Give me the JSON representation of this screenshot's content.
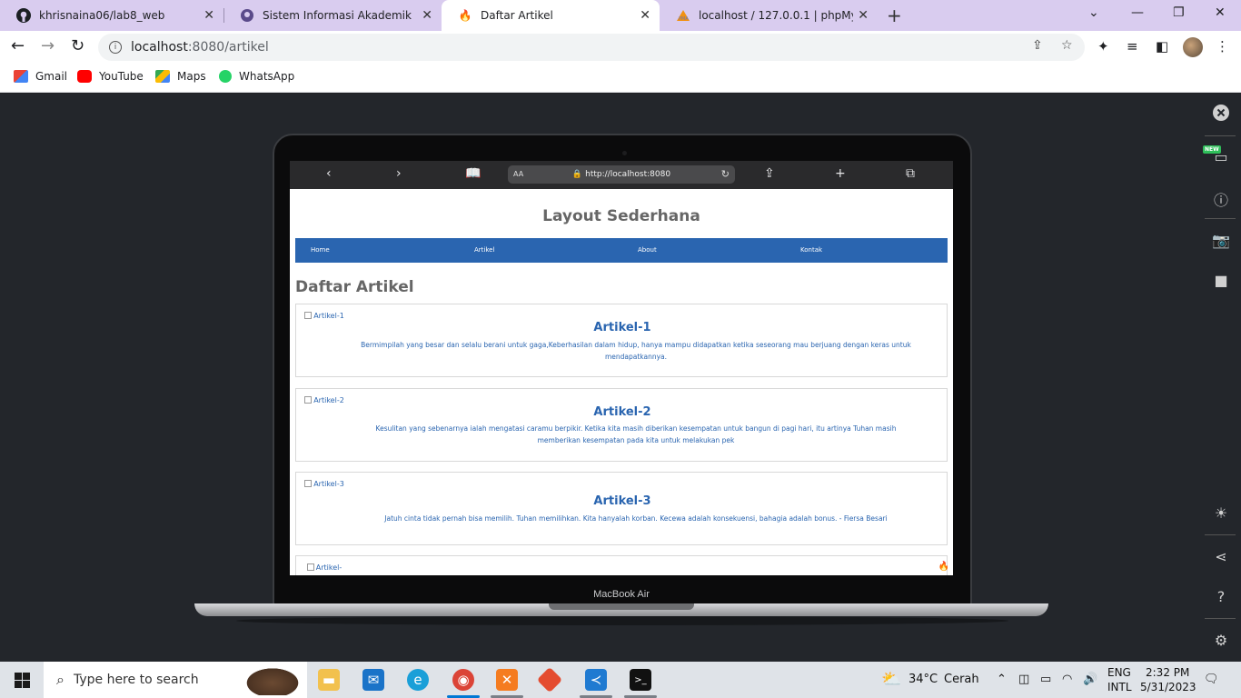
{
  "browser": {
    "tabs": [
      {
        "title": "khrisnaina06/lab8_web",
        "icon": "github-icon",
        "active": false
      },
      {
        "title": "Sistem Informasi Akademik",
        "icon": "academic-icon",
        "active": false
      },
      {
        "title": "Daftar Artikel",
        "icon": "flame-icon",
        "active": true
      },
      {
        "title": "localhost / 127.0.0.1 | phpMyAdmin",
        "icon": "phpmyadmin-icon",
        "active": false
      }
    ],
    "url_host": "localhost",
    "url_path": ":8080/artikel",
    "bookmarks": [
      {
        "label": "Gmail",
        "color": "#ea4335"
      },
      {
        "label": "YouTube",
        "color": "#ff0000"
      },
      {
        "label": "Maps",
        "color": "#34a853"
      },
      {
        "label": "WhatsApp",
        "color": "#25d366"
      }
    ]
  },
  "device": {
    "label": "MacBook Air",
    "safari_url": "http://localhost:8080",
    "safari_aa": "AA"
  },
  "site": {
    "title": "Layout Sederhana",
    "nav": [
      "Home",
      "Artikel",
      "About",
      "Kontak"
    ],
    "heading": "Daftar Artikel",
    "articles": [
      {
        "img_alt": "Artikel-1",
        "title": "Artikel-1",
        "desc": "Bermimpilah yang besar dan selalu berani untuk gaga,Keberhasilan dalam hidup, hanya mampu didapatkan ketika seseorang mau berjuang dengan keras untuk mendapatkannya."
      },
      {
        "img_alt": "Artikel-2",
        "title": "Artikel-2",
        "desc": "Kesulitan yang sebenarnya ialah mengatasi caramu berpikir. Ketika kita masih diberikan kesempatan untuk bangun di pagi hari, itu artinya Tuhan masih memberikan kesempatan pada kita untuk melakukan pek"
      },
      {
        "img_alt": "Artikel-3",
        "title": "Artikel-3",
        "desc": "Jatuh cinta tidak pernah bisa memilih. Tuhan memilihkan. Kita hanyalah korban. Kecewa adalah konsekuensi, bahagia adalah bonus. - Fiersa Besari"
      },
      {
        "img_alt": "Artikel-",
        "title": "",
        "desc": ""
      }
    ],
    "accent": "#2a65b0"
  },
  "side_panel": {
    "new_badge": "NEW"
  },
  "taskbar": {
    "search_placeholder": "Type here to search",
    "weather_temp": "34°C",
    "weather_text": "Cerah",
    "lang_top": "ENG",
    "lang_bottom": "INTL",
    "time": "2:32 PM",
    "date": "5/31/2023"
  }
}
